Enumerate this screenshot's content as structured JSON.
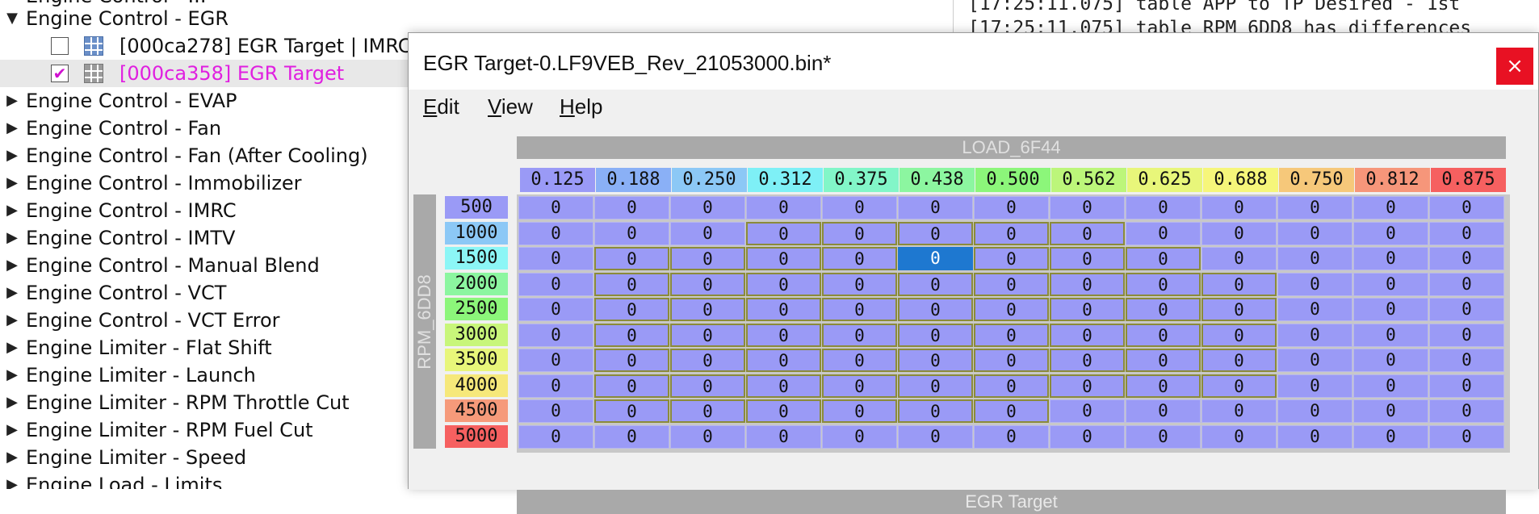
{
  "tree": {
    "partial_top": "Engine Control - ...",
    "rows": [
      {
        "type": "parent",
        "expanded": true,
        "label": "Engine Control - EGR"
      },
      {
        "type": "child",
        "checked": false,
        "label": "[000ca278] EGR Target | IMRC"
      },
      {
        "type": "child",
        "checked": true,
        "label": "[000ca358] EGR Target",
        "highlight": true
      },
      {
        "type": "parent",
        "expanded": false,
        "label": "Engine Control - EVAP"
      },
      {
        "type": "parent",
        "expanded": false,
        "label": "Engine Control - Fan"
      },
      {
        "type": "parent",
        "expanded": false,
        "label": "Engine Control - Fan (After Cooling)"
      },
      {
        "type": "parent",
        "expanded": false,
        "label": "Engine Control - Immobilizer"
      },
      {
        "type": "parent",
        "expanded": false,
        "label": "Engine Control - IMRC"
      },
      {
        "type": "parent",
        "expanded": false,
        "label": "Engine Control - IMTV"
      },
      {
        "type": "parent",
        "expanded": false,
        "label": "Engine Control - Manual Blend"
      },
      {
        "type": "parent",
        "expanded": false,
        "label": "Engine Control - VCT"
      },
      {
        "type": "parent",
        "expanded": false,
        "label": "Engine Control - VCT Error"
      },
      {
        "type": "parent",
        "expanded": false,
        "label": "Engine Limiter - Flat Shift"
      },
      {
        "type": "parent",
        "expanded": false,
        "label": "Engine Limiter - Launch"
      },
      {
        "type": "parent",
        "expanded": false,
        "label": "Engine Limiter - RPM Throttle Cut"
      },
      {
        "type": "parent",
        "expanded": false,
        "label": "Engine Limiter - RPM Fuel Cut"
      },
      {
        "type": "parent",
        "expanded": false,
        "label": "Engine Limiter - Speed"
      },
      {
        "type": "parent",
        "expanded": false,
        "label": "Engine Load - Limits"
      }
    ]
  },
  "log": {
    "lines": [
      "[17:25:11.075] table APP to TP Desired - 1st",
      "[17:25:11.075] table RPM 6DD8 has differences"
    ]
  },
  "dialog": {
    "title": "EGR Target-0.LF9VEB_Rev_21053000.bin*",
    "close_glyph": "×",
    "menu": [
      {
        "first": "E",
        "rest": "dit"
      },
      {
        "first": "V",
        "rest": "iew"
      },
      {
        "first": "H",
        "rest": "elp"
      }
    ],
    "x_axis_name": "LOAD_6F44",
    "y_axis_name": "RPM_6DD8",
    "table_name": "EGR Target",
    "x_values": [
      "0.125",
      "0.188",
      "0.250",
      "0.312",
      "0.375",
      "0.438",
      "0.500",
      "0.562",
      "0.625",
      "0.688",
      "0.750",
      "0.812",
      "0.875"
    ],
    "x_colors": [
      "#9a9af6",
      "#8ab0f6",
      "#8cc8f6",
      "#7ef0f6",
      "#82f6c8",
      "#8cf6a0",
      "#8cf67a",
      "#bcf67a",
      "#e8f67a",
      "#f6f67a",
      "#f6c87a",
      "#f6967a",
      "#f66060"
    ],
    "y_values": [
      "500",
      "1000",
      "1500",
      "2000",
      "2500",
      "3000",
      "3500",
      "4000",
      "4500",
      "5000"
    ],
    "y_colors": [
      "#9a9af6",
      "#8cc8f6",
      "#8cf6f6",
      "#8cf6a0",
      "#8cf67a",
      "#c8f67a",
      "#e8f67a",
      "#f6e87a",
      "#f69a7a",
      "#f66060"
    ],
    "cell_value": "0",
    "modified_cells": [
      [],
      [
        3,
        4,
        5,
        6,
        7
      ],
      [
        1,
        2,
        3,
        4,
        5,
        6,
        7,
        8
      ],
      [
        1,
        2,
        3,
        4,
        5,
        6,
        7,
        8,
        9
      ],
      [
        1,
        2,
        3,
        4,
        5,
        6,
        7,
        8,
        9
      ],
      [
        1,
        2,
        3,
        4,
        5,
        6,
        7,
        8,
        9
      ],
      [
        1,
        2,
        3,
        4,
        5,
        6,
        7,
        8,
        9
      ],
      [
        1,
        2,
        3,
        4,
        5,
        6,
        7,
        8,
        9
      ],
      [
        1,
        2,
        3,
        4,
        5,
        6
      ],
      []
    ],
    "selected_cell": {
      "row": 2,
      "col": 5
    }
  }
}
